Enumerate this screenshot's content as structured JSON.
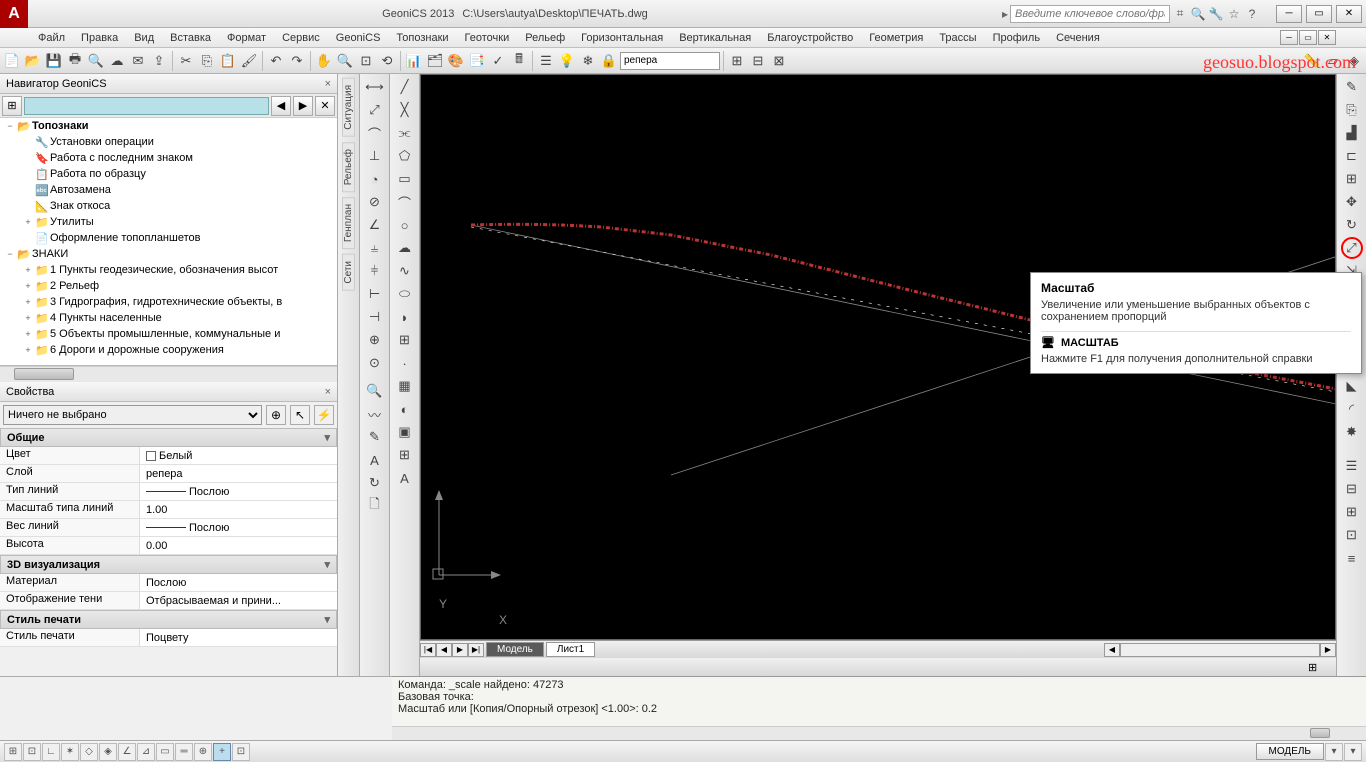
{
  "title": {
    "app": "GeoniCS 2013",
    "file": "C:\\Users\\autya\\Desktop\\ПЕЧАТЬ.dwg"
  },
  "search_placeholder": "Введите ключевое слово/фразу",
  "menu": [
    "Файл",
    "Правка",
    "Вид",
    "Вставка",
    "Формат",
    "Сервис",
    "GeoniCS",
    "Топознаки",
    "Геоточки",
    "Рельеф",
    "Горизонтальная",
    "Вертикальная",
    "Благоустройство",
    "Геометрия",
    "Трассы",
    "Профиль",
    "Сечения"
  ],
  "layer_current": "репера",
  "watermark": "geosuo.blogspot.com",
  "nav": {
    "title": "Навигатор GeoniCS",
    "items": [
      {
        "indent": 0,
        "exp": "−",
        "icon": "📂",
        "label": "Топознаки",
        "bold": true
      },
      {
        "indent": 1,
        "exp": "",
        "icon": "🔧",
        "label": "Установки операции"
      },
      {
        "indent": 1,
        "exp": "",
        "icon": "🔖",
        "label": "Работа с последним знаком"
      },
      {
        "indent": 1,
        "exp": "",
        "icon": "📋",
        "label": "Работа по образцу"
      },
      {
        "indent": 1,
        "exp": "",
        "icon": "🔤",
        "label": "Автозамена"
      },
      {
        "indent": 1,
        "exp": "",
        "icon": "📐",
        "label": "Знак откоса"
      },
      {
        "indent": 1,
        "exp": "+",
        "icon": "📁",
        "label": "Утилиты"
      },
      {
        "indent": 1,
        "exp": "",
        "icon": "📄",
        "label": "Оформление топопланшетов"
      },
      {
        "indent": 0,
        "exp": "−",
        "icon": "📂",
        "label": "ЗНАКИ"
      },
      {
        "indent": 1,
        "exp": "+",
        "icon": "📁",
        "label": "1 Пункты геодезические, обозначения высот"
      },
      {
        "indent": 1,
        "exp": "+",
        "icon": "📁",
        "label": "2 Рельеф"
      },
      {
        "indent": 1,
        "exp": "+",
        "icon": "📁",
        "label": "3 Гидрография, гидротехнические объекты, в"
      },
      {
        "indent": 1,
        "exp": "+",
        "icon": "📁",
        "label": "4 Пункты населенные"
      },
      {
        "indent": 1,
        "exp": "+",
        "icon": "📁",
        "label": "5 Объекты промышленные, коммунальные и"
      },
      {
        "indent": 1,
        "exp": "+",
        "icon": "📁",
        "label": "6 Дороги и дорожные сооружения"
      }
    ]
  },
  "props": {
    "title": "Свойства",
    "selection": "Ничего не выбрано",
    "sections": [
      {
        "name": "Общие",
        "rows": [
          {
            "n": "Цвет",
            "v": "Белый",
            "color": "#fff"
          },
          {
            "n": "Слой",
            "v": "репера"
          },
          {
            "n": "Тип линий",
            "v": "Послою",
            "line": true
          },
          {
            "n": "Масштаб типа линий",
            "v": "1.00"
          },
          {
            "n": "Вес линий",
            "v": "Послою",
            "line": true
          },
          {
            "n": "Высота",
            "v": "0.00"
          }
        ]
      },
      {
        "name": "3D визуализация",
        "rows": [
          {
            "n": "Материал",
            "v": "Послою"
          },
          {
            "n": "Отображение тени",
            "v": "Отбрасываемая и прини..."
          }
        ]
      },
      {
        "name": "Стиль печати",
        "rows": [
          {
            "n": "Стиль печати",
            "v": "Поцвету"
          }
        ]
      }
    ]
  },
  "vtabs": [
    "Ситуация",
    "Рельеф",
    "Генплан",
    "Сети"
  ],
  "tabs": {
    "items": [
      "Модель",
      "Лист1"
    ],
    "active": 0
  },
  "cmd": {
    "line1": "Команда: _scale найдено: 47273",
    "line2": "Базовая точка:",
    "line3": " ",
    "line4": "Масштаб или  [Копия/Опорный отрезок] <1.00>: 0.2"
  },
  "status_model": "МОДЕЛЬ",
  "tooltip": {
    "title": "Масштаб",
    "body": "Увеличение или уменьшение выбранных объектов с сохранением пропорций",
    "cmd": "МАСШТАБ",
    "help": "Нажмите F1 для получения дополнительной справки"
  },
  "axis": {
    "x": "X",
    "y": "Y"
  }
}
